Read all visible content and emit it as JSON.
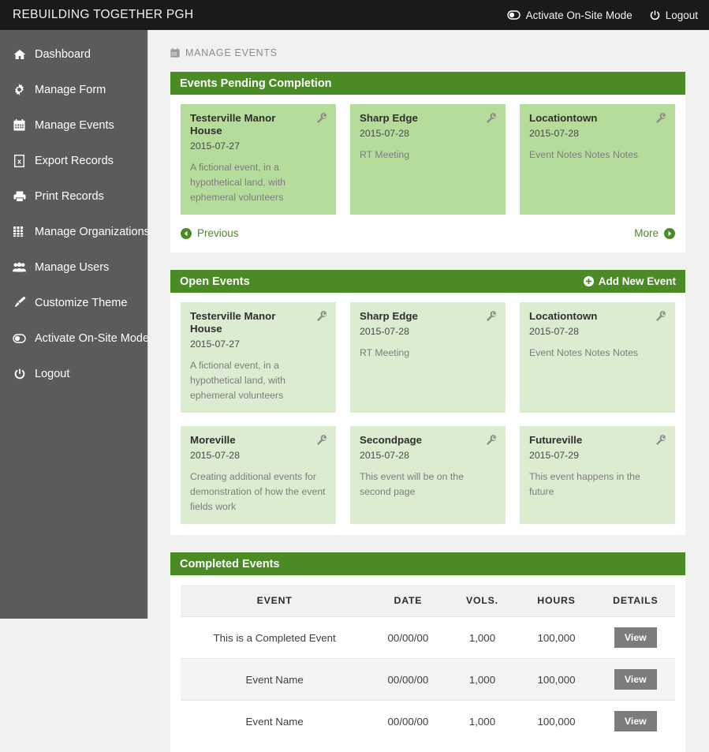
{
  "topbar": {
    "brand": "REBUILDING TOGETHER PGH",
    "links": [
      {
        "label": "Activate On-Site Mode",
        "icon": "toggle-icon"
      },
      {
        "label": "Logout",
        "icon": "power-icon"
      }
    ]
  },
  "sidebar": {
    "items": [
      {
        "label": "Dashboard",
        "icon": "home-icon"
      },
      {
        "label": "Manage Form",
        "icon": "gear-icon"
      },
      {
        "label": "Manage Events",
        "icon": "calendar-icon"
      },
      {
        "label": "Export Records",
        "icon": "excel-file-icon"
      },
      {
        "label": "Print Records",
        "icon": "printer-icon"
      },
      {
        "label": "Manage Organizations",
        "icon": "grid-icon"
      },
      {
        "label": "Manage Users",
        "icon": "users-icon"
      },
      {
        "label": "Customize Theme",
        "icon": "paintbrush-icon"
      },
      {
        "label": "Activate On-Site Mode",
        "icon": "toggle-icon"
      },
      {
        "label": "Logout",
        "icon": "power-icon"
      }
    ]
  },
  "breadcrumb": {
    "icon": "calendar-icon",
    "label": "MANAGE EVENTS"
  },
  "pending_panel": {
    "title": "Events Pending Completion",
    "cards": [
      {
        "title": "Testerville Manor House",
        "date": "2015-07-27",
        "notes": "A fictional event, in a hypothetical land, with ephemeral volunteers"
      },
      {
        "title": "Sharp Edge",
        "date": "2015-07-28",
        "notes": "RT Meeting"
      },
      {
        "title": "Locationtown",
        "date": "2015-07-28",
        "notes": "Event Notes Notes Notes"
      }
    ],
    "pager": {
      "previous": "Previous",
      "more": "More"
    }
  },
  "open_panel": {
    "title": "Open Events",
    "add_label": "Add New Event",
    "cards_row1": [
      {
        "title": "Testerville Manor House",
        "date": "2015-07-27",
        "notes": "A fictional event, in a hypothetical land, with ephemeral volunteers"
      },
      {
        "title": "Sharp Edge",
        "date": "2015-07-28",
        "notes": "RT Meeting"
      },
      {
        "title": "Locationtown",
        "date": "2015-07-28",
        "notes": "Event Notes Notes Notes"
      }
    ],
    "cards_row2": [
      {
        "title": "Moreville",
        "date": "2015-07-28",
        "notes": "Creating additional events for demonstration of how the event fields work"
      },
      {
        "title": "Secondpage",
        "date": "2015-07-28",
        "notes": "This event will be on the second page"
      },
      {
        "title": "Futureville",
        "date": "2015-07-29",
        "notes": "This event happens in the future"
      }
    ]
  },
  "completed_panel": {
    "title": "Completed Events",
    "columns": [
      "EVENT",
      "DATE",
      "VOLS.",
      "HOURS",
      "DETAILS"
    ],
    "rows": [
      {
        "event": "This is a Completed Event",
        "date": "00/00/00",
        "vols": "1,000",
        "hours": "100,000",
        "action": "View"
      },
      {
        "event": "Event Name",
        "date": "00/00/00",
        "vols": "1,000",
        "hours": "100,000",
        "action": "View"
      },
      {
        "event": "Event Name",
        "date": "00/00/00",
        "vols": "1,000",
        "hours": "100,000",
        "action": "View"
      }
    ]
  },
  "colors": {
    "topbar": "#1a1a1a",
    "sidebar": "#5b5b5b",
    "panel_header_green": "#4b8b25",
    "pending_card": "#b6dc9c",
    "open_card": "#dcecd0",
    "content_bg": "#f1f1f0",
    "view_button": "#7c7c7c"
  }
}
